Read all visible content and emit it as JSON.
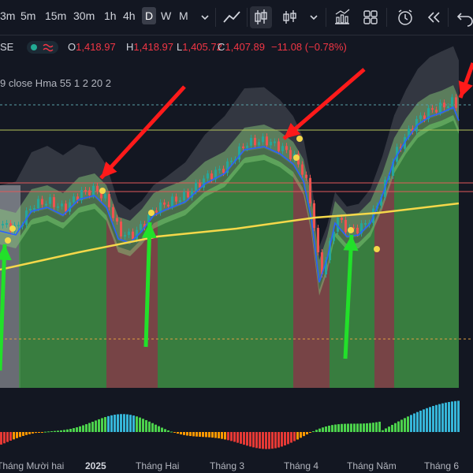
{
  "toolbar": {
    "timeframes": [
      "3m",
      "5m",
      "15m",
      "30m",
      "1h",
      "4h",
      "D",
      "W",
      "M"
    ],
    "active_timeframe": "D",
    "icons": [
      "chevron-down-icon",
      "line-tool-icon",
      "candles-icon",
      "bar-chart-icon",
      "chevron-down-icon",
      "indicators-icon",
      "layout-grid-icon",
      "replay-alert-icon",
      "rewind-icon",
      "undo-icon"
    ]
  },
  "legend": {
    "symbol_fragment": "SE",
    "open_label": "O",
    "open": "1,418.97",
    "high_label": "H",
    "high": "1,418.97",
    "low_label": "L",
    "low": "1,405.72",
    "close_label": "C",
    "close": "1,407.89",
    "change": "−11.08 (−0.78%)"
  },
  "indicator_legend": {
    "text": "9 close Hma 55 1 2 20 2"
  },
  "x_axis": [
    "Tháng Mười hai",
    "2025",
    "Tháng Hai",
    "Tháng 3",
    "Tháng 4",
    "Tháng Năm",
    "Tháng 6"
  ],
  "colors": {
    "background": "#131722",
    "up": "#26a69a",
    "down": "#ef5350",
    "green_zone": "#4caf50",
    "red_zone": "#b05050",
    "hma": "#f5d84a",
    "arrow_red": "#ff1a1a",
    "arrow_green": "#22e02a"
  }
}
